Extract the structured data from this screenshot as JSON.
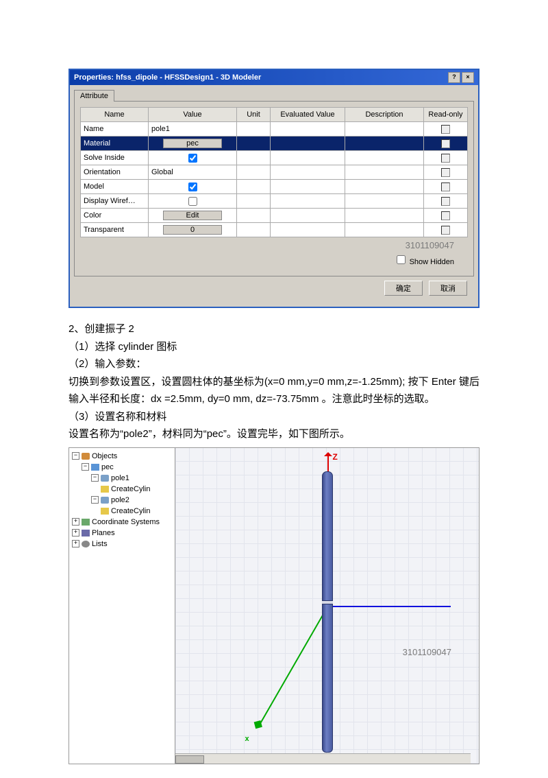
{
  "dialog": {
    "title": "Properties: hfss_dipole - HFSSDesign1 - 3D Modeler",
    "tab": "Attribute",
    "columns": [
      "Name",
      "Value",
      "Unit",
      "Evaluated Value",
      "Description",
      "Read-only"
    ],
    "rows": [
      {
        "name": "Name",
        "value": "pole1",
        "type": "text"
      },
      {
        "name": "Material",
        "value": "pec",
        "type": "btn",
        "selected": true
      },
      {
        "name": "Solve Inside",
        "value": "",
        "type": "chk",
        "checked": true
      },
      {
        "name": "Orientation",
        "value": "Global",
        "type": "text"
      },
      {
        "name": "Model",
        "value": "",
        "type": "chk",
        "checked": true
      },
      {
        "name": "Display Wiref…",
        "value": "",
        "type": "chk",
        "checked": false
      },
      {
        "name": "Color",
        "value": "Edit",
        "type": "btn"
      },
      {
        "name": "Transparent",
        "value": "0",
        "type": "btn"
      }
    ],
    "watermark": "3101109047",
    "show_hidden": "Show Hidden",
    "ok": "确定",
    "cancel": "取消"
  },
  "text": {
    "l1": "2、创建振子 2",
    "l2": "（1）选择 cylinder 图标",
    "l3": "（2）输入参数：",
    "l4": "切换到参数设置区，设置圆柱体的基坐标为(x=0 mm,y=0 mm,z=-1.25mm); 按下 Enter 键后输入半径和长度：dx =2.5mm, dy=0 mm, dz=-73.75mm 。注意此时坐标的选取。",
    "l5": "（3）设置名称和材料",
    "l6": "设置名称为“pole2”，材料同为“pec”。设置完毕，如下图所示。"
  },
  "tree": {
    "objects": "Objects",
    "pec": "pec",
    "pole1": "pole1",
    "create1": "CreateCylin",
    "pole2": "pole2",
    "create2": "CreateCylin",
    "cs": "Coordinate Systems",
    "planes": "Planes",
    "lists": "Lists"
  },
  "viewport": {
    "z": "Z",
    "x": "x",
    "watermark": "3101109047"
  }
}
